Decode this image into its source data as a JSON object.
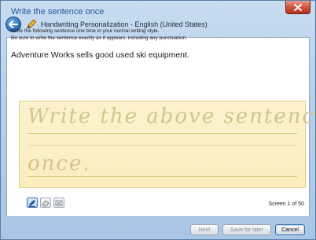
{
  "window": {
    "title": "Handwriting Personalization - English (United States)",
    "close_icon": "close-icon",
    "back_icon": "back-arrow-icon",
    "app_icon": "pen-icon"
  },
  "page": {
    "heading": "Write the sentence once",
    "instruction_line1": "Write the following sentence one time in your normal writing style.",
    "instruction_line2": "Be sure to write the sentence exactly as it appears, including any punctuation.",
    "sentence": "Adventure Works sells good used ski equipment."
  },
  "writing_area": {
    "line1": "Write the above sentence",
    "line2": "once.",
    "background_color": "#faeebd"
  },
  "tools": [
    {
      "name": "pen-tool",
      "icon": "pen-icon",
      "active": true
    },
    {
      "name": "eraser-tool",
      "icon": "eraser-icon",
      "active": false
    },
    {
      "name": "clear-tool",
      "icon": "clear-icon",
      "active": false
    }
  ],
  "status": {
    "screen_counter": "Screen 1 of 50"
  },
  "footer": {
    "next_label": "Next",
    "save_label": "Save for later",
    "cancel_label": "Cancel"
  }
}
